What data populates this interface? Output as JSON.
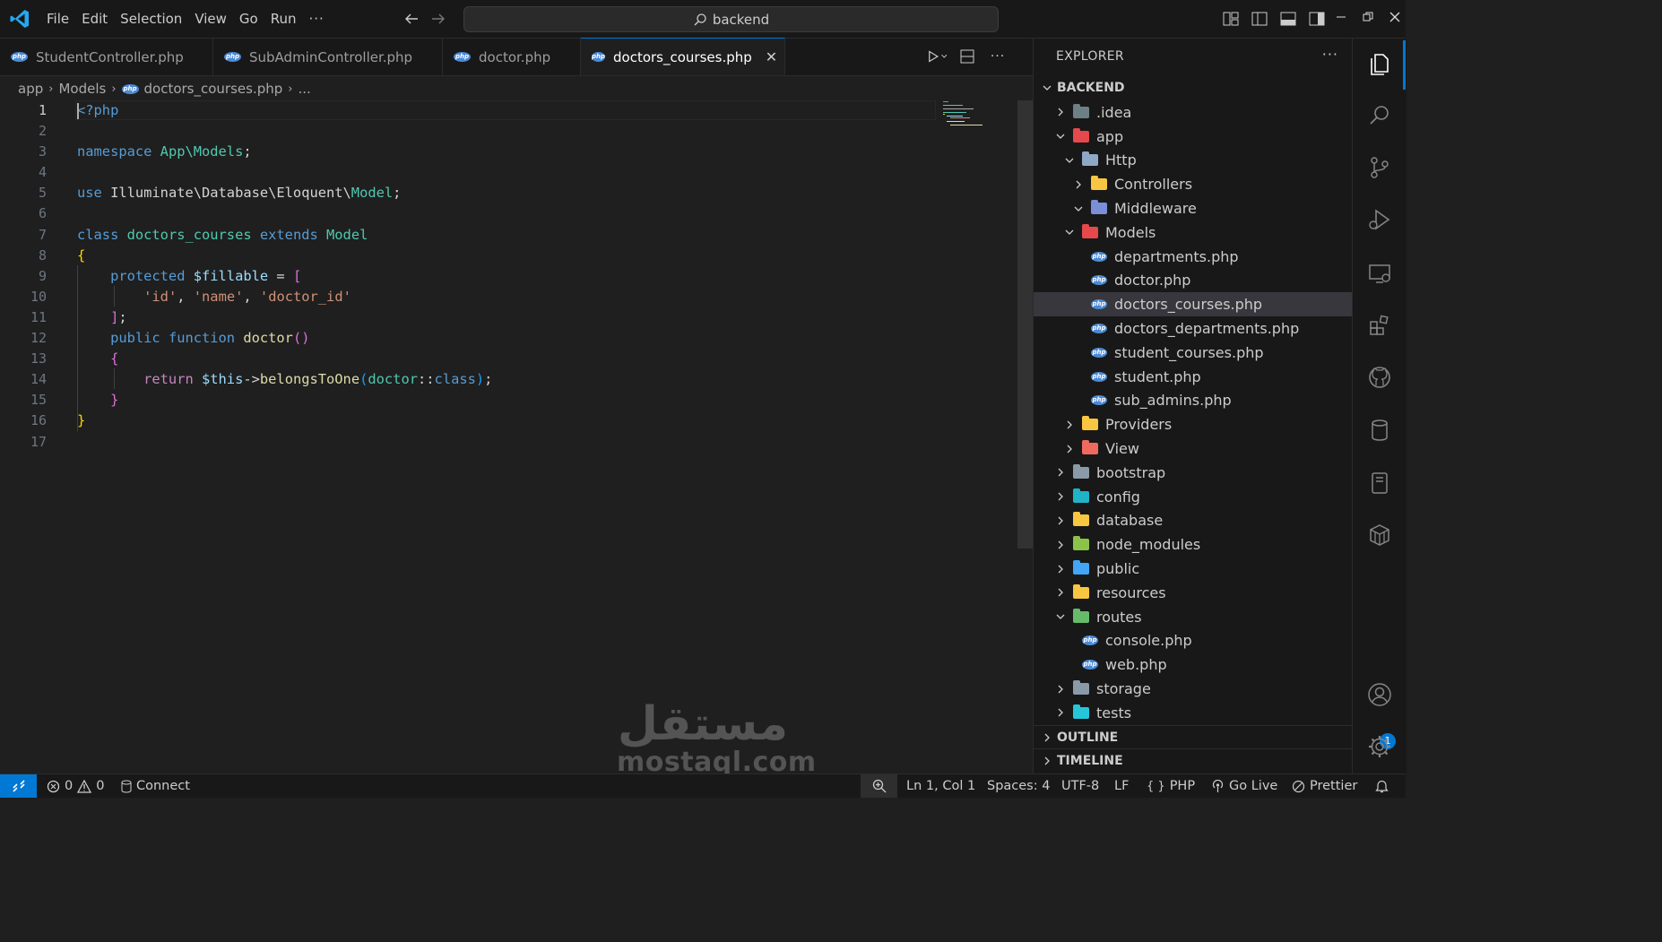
{
  "titlebar": {
    "menu": [
      "File",
      "Edit",
      "Selection",
      "View",
      "Go",
      "Run",
      "···"
    ],
    "search_text": "backend"
  },
  "tabs": [
    {
      "label": "StudentController.php",
      "active": false
    },
    {
      "label": "SubAdminController.php",
      "active": false
    },
    {
      "label": "doctor.php",
      "active": false
    },
    {
      "label": "doctors_courses.php",
      "active": true
    }
  ],
  "breadcrumb": [
    "app",
    "Models",
    "doctors_courses.php",
    "..."
  ],
  "code": {
    "line_numbers": [
      "1",
      "2",
      "3",
      "4",
      "5",
      "6",
      "7",
      "8",
      "9",
      "10",
      "11",
      "12",
      "13",
      "14",
      "15",
      "16",
      "17"
    ],
    "current_line": 1,
    "lines": [
      [
        {
          "t": "<?php",
          "c": "k-tag"
        }
      ],
      [],
      [
        {
          "t": "namespace ",
          "c": "k-blue"
        },
        {
          "t": "App\\Models",
          "c": "k-type"
        },
        {
          "t": ";",
          "c": "k-plain"
        }
      ],
      [],
      [
        {
          "t": "use ",
          "c": "k-blue"
        },
        {
          "t": "Illuminate\\Database\\Eloquent\\",
          "c": "k-plain"
        },
        {
          "t": "Model",
          "c": "k-type"
        },
        {
          "t": ";",
          "c": "k-plain"
        }
      ],
      [],
      [
        {
          "t": "class ",
          "c": "k-blue"
        },
        {
          "t": "doctors_courses ",
          "c": "k-type"
        },
        {
          "t": "extends ",
          "c": "k-blue"
        },
        {
          "t": "Model",
          "c": "k-type"
        }
      ],
      [
        {
          "t": "{",
          "c": "k-brk1"
        }
      ],
      [
        {
          "t": "    protected ",
          "c": "k-blue"
        },
        {
          "t": "$fillable",
          "c": "k-var"
        },
        {
          "t": " = ",
          "c": "k-plain"
        },
        {
          "t": "[",
          "c": "k-brk2"
        }
      ],
      [
        {
          "t": "        ",
          "c": "k-plain"
        },
        {
          "t": "'id'",
          "c": "k-str"
        },
        {
          "t": ", ",
          "c": "k-plain"
        },
        {
          "t": "'name'",
          "c": "k-str"
        },
        {
          "t": ", ",
          "c": "k-plain"
        },
        {
          "t": "'doctor_id'",
          "c": "k-str"
        }
      ],
      [
        {
          "t": "    ",
          "c": "k-plain"
        },
        {
          "t": "]",
          "c": "k-brk2"
        },
        {
          "t": ";",
          "c": "k-plain"
        }
      ],
      [
        {
          "t": "    public ",
          "c": "k-blue"
        },
        {
          "t": "function ",
          "c": "k-blue"
        },
        {
          "t": "doctor",
          "c": "k-fn"
        },
        {
          "t": "()",
          "c": "k-brk2"
        }
      ],
      [
        {
          "t": "    ",
          "c": "k-plain"
        },
        {
          "t": "{",
          "c": "k-brk2"
        }
      ],
      [
        {
          "t": "        return ",
          "c": "k-ctl"
        },
        {
          "t": "$this",
          "c": "k-var"
        },
        {
          "t": "->",
          "c": "k-plain"
        },
        {
          "t": "belongsToOne",
          "c": "k-fn"
        },
        {
          "t": "(",
          "c": "k-brk3"
        },
        {
          "t": "doctor",
          "c": "k-type"
        },
        {
          "t": "::",
          "c": "k-plain"
        },
        {
          "t": "class",
          "c": "k-blue"
        },
        {
          "t": ")",
          "c": "k-brk3"
        },
        {
          "t": ";",
          "c": "k-plain"
        }
      ],
      [
        {
          "t": "    ",
          "c": "k-plain"
        },
        {
          "t": "}",
          "c": "k-brk2"
        }
      ],
      [
        {
          "t": "}",
          "c": "k-brk1"
        }
      ],
      []
    ]
  },
  "explorer": {
    "title": "EXPLORER",
    "more": "···",
    "root": "BACKEND",
    "items": [
      {
        "label": ".idea",
        "depth": 1,
        "kind": "folder",
        "open": false,
        "color": "#6d8086"
      },
      {
        "label": "app",
        "depth": 1,
        "kind": "folder",
        "open": true,
        "color": "#e5494b"
      },
      {
        "label": "Http",
        "depth": 2,
        "kind": "folder",
        "open": true,
        "color": "#8fa8c8"
      },
      {
        "label": "Controllers",
        "depth": 3,
        "kind": "folder",
        "open": false,
        "color": "#f9c642"
      },
      {
        "label": "Middleware",
        "depth": 3,
        "kind": "folder",
        "open": true,
        "color": "#7a8fd8"
      },
      {
        "label": "Models",
        "depth": 2,
        "kind": "folder",
        "open": true,
        "color": "#e5494b"
      },
      {
        "label": "departments.php",
        "depth": 3,
        "kind": "php"
      },
      {
        "label": "doctor.php",
        "depth": 3,
        "kind": "php"
      },
      {
        "label": "doctors_courses.php",
        "depth": 3,
        "kind": "php",
        "selected": true
      },
      {
        "label": "doctors_departments.php",
        "depth": 3,
        "kind": "php"
      },
      {
        "label": "student_courses.php",
        "depth": 3,
        "kind": "php"
      },
      {
        "label": "student.php",
        "depth": 3,
        "kind": "php"
      },
      {
        "label": "sub_admins.php",
        "depth": 3,
        "kind": "php"
      },
      {
        "label": "Providers",
        "depth": 2,
        "kind": "folder",
        "open": false,
        "color": "#f9c642"
      },
      {
        "label": "View",
        "depth": 2,
        "kind": "folder",
        "open": false,
        "color": "#ef6a5e"
      },
      {
        "label": "bootstrap",
        "depth": 1,
        "kind": "folder",
        "open": false,
        "color": "#8a9aa8"
      },
      {
        "label": "config",
        "depth": 1,
        "kind": "folder",
        "open": false,
        "color": "#20b3c8"
      },
      {
        "label": "database",
        "depth": 1,
        "kind": "folder",
        "open": false,
        "color": "#f9c642"
      },
      {
        "label": "node_modules",
        "depth": 1,
        "kind": "folder",
        "open": false,
        "color": "#8bc34a"
      },
      {
        "label": "public",
        "depth": 1,
        "kind": "folder",
        "open": false,
        "color": "#42a5f5"
      },
      {
        "label": "resources",
        "depth": 1,
        "kind": "folder",
        "open": false,
        "color": "#f9c642"
      },
      {
        "label": "routes",
        "depth": 1,
        "kind": "folder",
        "open": true,
        "color": "#66bb6a"
      },
      {
        "label": "console.php",
        "depth": 2,
        "kind": "php"
      },
      {
        "label": "web.php",
        "depth": 2,
        "kind": "php"
      },
      {
        "label": "storage",
        "depth": 1,
        "kind": "folder",
        "open": false,
        "color": "#8a9aa8"
      },
      {
        "label": "tests",
        "depth": 1,
        "kind": "folder",
        "open": false,
        "color": "#26c6da"
      }
    ],
    "outline": "OUTLINE",
    "timeline": "TIMELINE"
  },
  "activity": {
    "accounts_badge": "1"
  },
  "statusbar": {
    "errors": "0",
    "warnings": "0",
    "connect": "Connect",
    "position": "Ln 1, Col 1",
    "spaces": "Spaces: 4",
    "encoding": "UTF-8",
    "eol": "LF",
    "language": "PHP",
    "golive": "Go Live",
    "prettier": "Prettier"
  },
  "watermark": {
    "arabic": "مستقل",
    "latin": "mostaql.com"
  },
  "colors": {
    "accent": "#0078d4",
    "editor_bg": "#1f1f1f",
    "chrome_bg": "#181818",
    "selected_row": "#37373d"
  },
  "icons": [
    "vscode-logo",
    "back-arrow-icon",
    "forward-arrow-icon",
    "search-icon",
    "layout-icons",
    "run-icon",
    "split-editor-icon",
    "files-icon",
    "search-view-icon",
    "source-control-icon",
    "run-debug-icon",
    "remote-explorer-icon",
    "extensions-icon",
    "github-icon",
    "database-icon",
    "notebook-icon",
    "package-icon",
    "accounts-icon",
    "settings-gear-icon",
    "bell-icon"
  ]
}
